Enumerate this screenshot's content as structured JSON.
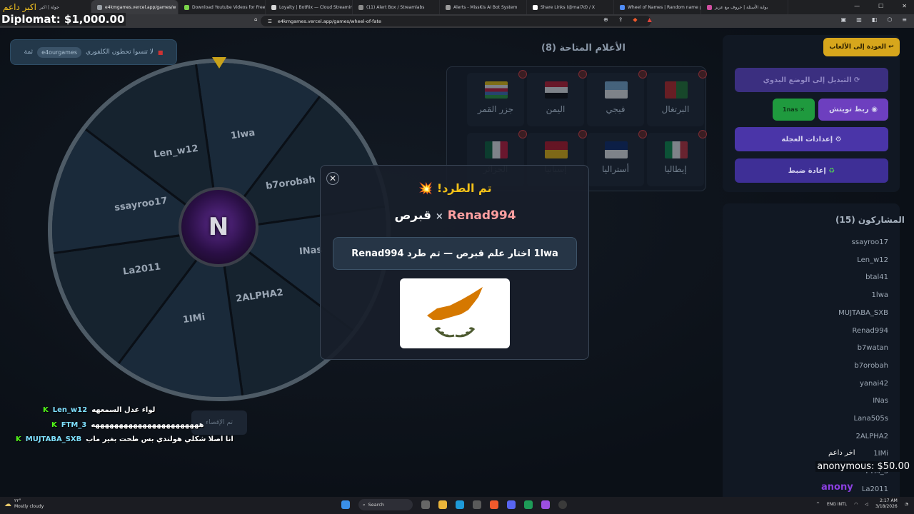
{
  "overlay": {
    "top_left_text": "اكبر داعم",
    "diplomat": "Diplomat: $1,000.00",
    "donation_label": "اخر داعم",
    "donation_text": "anonymous: $50.00",
    "donation_partial": "anony"
  },
  "browser": {
    "tabs": [
      {
        "title": "جولة | اكبر داعم التفاعلية",
        "active": false,
        "color": "#f0c020"
      },
      {
        "title": "e4kmgames.vercel.app/games/w",
        "active": true,
        "color": "#9aa0a6"
      },
      {
        "title": "Download Youtube Videos for Free",
        "active": false,
        "color": "#7ad34a"
      },
      {
        "title": "Loyalty | BotRix — Cloud Streaming",
        "active": false,
        "color": "#d6d6d6"
      },
      {
        "title": "(11) Alert Box / Streamlabs",
        "active": false,
        "color": "#8b8b8b"
      },
      {
        "title": "Alerts - MissKis AI Bot System",
        "active": false,
        "color": "#9b9b9b"
      },
      {
        "title": "Share Links (@mai7d) / X",
        "active": false,
        "color": "#ffffff"
      },
      {
        "title": "Wheel of Names | Random name pi",
        "active": false,
        "color": "#4f8cf7"
      },
      {
        "title": "بوابة الأسئلة | حروف مع عزيز",
        "active": false,
        "color": "#d04fa0"
      }
    ],
    "url": "e4kmgames.vercel.app/games/wheel-of-fate"
  },
  "game": {
    "top_pill_text": "لا تنسوا تحطون الكلفوري",
    "top_pill_tag": "e4ourgames",
    "top_pill_suffix": "ثمة",
    "hub_letter": "N",
    "wheel_labels": [
      "1lwa",
      "b7orobah",
      "INas",
      "2ALPHA2",
      "1IMi",
      "La2011",
      "ssayroo17",
      "Len_w12"
    ],
    "dim_button": "تم الإقصاء",
    "flags_title": "الأعلام المتاحة (8)",
    "flags": [
      {
        "name": "البرتغال",
        "colors": [
          "#cc1f1f",
          "#1a7a2c"
        ]
      },
      {
        "name": "فيجي",
        "colors": [
          "#7fb6e0",
          "#ffffff"
        ]
      },
      {
        "name": "اليمن",
        "colors": [
          "#ce1126",
          "#ffffff",
          "#000000"
        ]
      },
      {
        "name": "جزر القمر",
        "colors": [
          "#ffd000",
          "#ffffff",
          "#d21034",
          "#3a75c4",
          "#23a33b"
        ]
      },
      {
        "name": "إيطاليا",
        "colors": [
          "#009246",
          "#ffffff",
          "#ce2b37"
        ]
      },
      {
        "name": "أستراليا",
        "colors": [
          "#012169",
          "#ffffff"
        ]
      },
      {
        "name": "إسبانيا",
        "colors": [
          "#c60b1e",
          "#ffc400"
        ]
      },
      {
        "name": "الجزائر",
        "colors": [
          "#006233",
          "#ffffff",
          "#d21034"
        ]
      }
    ],
    "back_button": "العودة إلى الألعاب",
    "manual_button": "التبديل إلى الوضع اليدوي",
    "twitch_button": "ربط تويتش",
    "twitch_user": "1nas",
    "settings_button": "إعدادات العجلة",
    "reset_button": "إعادة ضبط",
    "participants_title": "المشاركون (15)",
    "participants": [
      "ssayroo17",
      "Len_w12",
      "btal41",
      "1lwa",
      "MUJTABA_SXB",
      "Renad994",
      "b7watan",
      "b7orobah",
      "yanai42",
      "INas",
      "Lana505s",
      "2ALPHA2",
      "1IMi",
      "FTM_3",
      "La2011"
    ]
  },
  "modal": {
    "title": "تم الطرد!",
    "burst_icon": "💥",
    "kicked_user": "Renad994",
    "times": "×",
    "flag_name": "قبرص",
    "message": "1lwa اختار علم قبرص — تم طرد Renad994",
    "flag_colors": {
      "island": "#d57800",
      "branches": "#4e5b31"
    }
  },
  "chat": [
    {
      "user": "Len_w12",
      "text": "لواء عدل السمعهه"
    },
    {
      "user": "FTM_3",
      "text": "هههههههههههههههههههههههه"
    },
    {
      "user": "MUJTABA_SXB",
      "text": "انا اصلا شكلي هولندي بس طحت بغير ماب"
    }
  ],
  "taskbar": {
    "temp": "٢٢°",
    "weather": "Mostly cloudy",
    "search": "Search",
    "lang": "ENG INTL",
    "time": "2:17 AM",
    "date": "3/18/2026"
  }
}
